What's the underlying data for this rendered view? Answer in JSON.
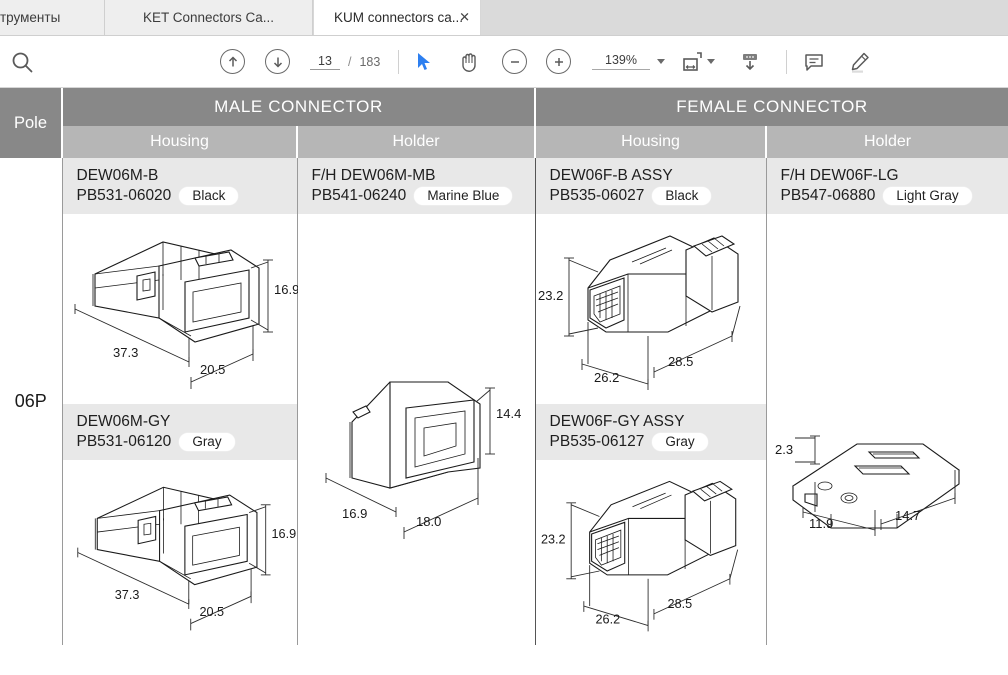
{
  "browser": {
    "tabs": [
      {
        "label": "трументы",
        "active": false,
        "closable": false
      },
      {
        "label": "KET Connectors Ca...",
        "active": false,
        "closable": false
      },
      {
        "label": "KUM connectors ca...",
        "active": true,
        "closable": true,
        "close_icon": "close-icon"
      }
    ]
  },
  "toolbar": {
    "search_icon": "search-icon",
    "prev_page_icon": "arrow-up-circle-icon",
    "next_page_icon": "arrow-down-circle-icon",
    "current_page": "13",
    "page_separator": "/",
    "total_pages": "183",
    "select_tool_icon": "cursor-select-icon",
    "pan_tool_icon": "hand-pan-icon",
    "zoom_out_icon": "minus-circle-icon",
    "zoom_in_icon": "plus-circle-icon",
    "zoom_level": "139%",
    "zoom_dropdown_icon": "chevron-down-icon",
    "fit_page_icon": "fit-page-icon",
    "fit_page_dropdown_icon": "chevron-down-icon",
    "download_icon": "download-icon",
    "comment_icon": "comment-icon",
    "highlight_icon": "highlighter-pen-icon"
  },
  "document": {
    "table": {
      "pole_header": "Pole",
      "groups": [
        {
          "label": "MALE CONNECTOR",
          "columns": [
            "Housing",
            "Holder"
          ]
        },
        {
          "label": "FEMALE CONNECTOR",
          "columns": [
            "Housing",
            "Holder"
          ]
        }
      ],
      "pole_value": "06P",
      "cells": {
        "male_housing_1": {
          "name": "DEW06M-B",
          "part_number": "PB531-06020",
          "color": "Black",
          "dimensions": {
            "length": "37.3",
            "height": "16.9",
            "width": "20.5"
          }
        },
        "male_holder": {
          "name": "F/H DEW06M-MB",
          "part_number": "PB541-06240",
          "color": "Marine Blue",
          "dimensions": {
            "length": "16.9",
            "height": "14.4",
            "width": "18.0"
          }
        },
        "female_housing_1": {
          "name": "DEW06F-B ASSY",
          "part_number": "PB535-06027",
          "color": "Black",
          "dimensions": {
            "height": "23.2",
            "length": "26.2",
            "width": "28.5"
          }
        },
        "female_holder": {
          "name": "F/H DEW06F-LG",
          "part_number": "PB547-06880",
          "color": "Light Gray",
          "dimensions": {
            "height": "2.3",
            "length": "11.9",
            "width": "14.7"
          }
        },
        "male_housing_2": {
          "name": "DEW06M-GY",
          "part_number": "PB531-06120",
          "color": "Gray",
          "dimensions": {
            "length": "37.3",
            "height": "16.9",
            "width": "20.5"
          }
        },
        "female_housing_2": {
          "name": "DEW06F-GY ASSY",
          "part_number": "PB535-06127",
          "color": "Gray",
          "dimensions": {
            "height": "23.2",
            "length": "26.2",
            "width": "28.5"
          }
        }
      }
    }
  },
  "colors": {
    "header_gray": "#888888",
    "subheader_gray": "#b6b6b6",
    "cell_gray": "#e8e8e8",
    "accent_blue": "#2d7ff0"
  }
}
